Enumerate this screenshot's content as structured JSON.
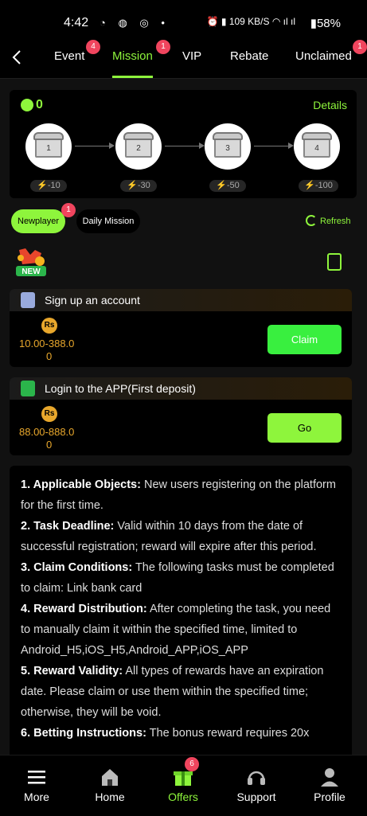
{
  "status_bar": {
    "time": "4:42",
    "battery": "58%",
    "speed": "109 KB/S"
  },
  "tabs": [
    {
      "label": "Event",
      "badge": "4"
    },
    {
      "label": "Mission",
      "badge": "1",
      "active": true
    },
    {
      "label": "VIP"
    },
    {
      "label": "Rebate"
    },
    {
      "label": "Unclaimed",
      "badge": "1"
    }
  ],
  "progress": {
    "bolt_count": "0",
    "details_label": "Details",
    "chests": [
      {
        "number": "1",
        "reward": "-10"
      },
      {
        "number": "2",
        "reward": "-30"
      },
      {
        "number": "3",
        "reward": "-50"
      },
      {
        "number": "4",
        "reward": "-100"
      }
    ]
  },
  "filters": {
    "newplayer_label": "Newplayer",
    "newplayer_badge": "1",
    "daily_label": "Daily Mission",
    "refresh_label": "Refresh"
  },
  "new_badge_text": "NEW",
  "tasks": [
    {
      "title": "Sign up an account",
      "currency": "Rs",
      "amount_line1": "10.00-388.0",
      "amount_line2": "0",
      "button": "Claim",
      "button_color": "#39ef3f"
    },
    {
      "title": "Login to the APP(First deposit)",
      "currency": "Rs",
      "amount_line1": "88.00-888.0",
      "amount_line2": "0",
      "button": "Go",
      "button_color": "#8ef53c"
    }
  ],
  "rules": [
    {
      "heading": "1. Applicable Objects:",
      "text": " New users registering on the platform for the first time."
    },
    {
      "heading": "2. Task Deadline:",
      "text": " Valid within 10 days from the date of successful registration; reward will expire after this period."
    },
    {
      "heading": "3. Claim Conditions:",
      "text": " The following tasks must be completed to claim: Link bank card"
    },
    {
      "heading": "4. Reward Distribution:",
      "text": " After completing the task, you need to manually claim it within the specified time, limited to Android_H5,iOS_H5,Android_APP,iOS_APP"
    },
    {
      "heading": "5. Reward Validity:",
      "text": " All types of rewards have an expiration date. Please claim or use them within the specified time; otherwise, they will be void."
    },
    {
      "heading": "6. Betting Instructions:",
      "text": " The bonus reward requires 20x"
    }
  ],
  "bottom_nav": [
    {
      "label": "More",
      "icon": "menu-icon"
    },
    {
      "label": "Home",
      "icon": "home-icon"
    },
    {
      "label": "Offers",
      "icon": "gift-icon",
      "badge": "6",
      "active": true
    },
    {
      "label": "Support",
      "icon": "headset-icon"
    },
    {
      "label": "Profile",
      "icon": "person-icon"
    }
  ],
  "colors": {
    "accent": "#8ef53c",
    "badge": "#f0455e",
    "currency": "#e8a72c"
  }
}
